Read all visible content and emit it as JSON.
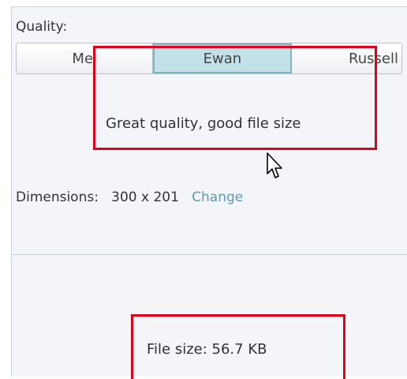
{
  "quality": {
    "label": "Quality:",
    "options": [
      "Mel",
      "Ewan",
      "Russell"
    ],
    "selected": "Ewan",
    "description": "Great quality, good file size"
  },
  "dimensions": {
    "label": "Dimensions:",
    "value": "300 x 201",
    "change_link": "Change"
  },
  "file_size": {
    "text": "File size: 56.7 KB"
  },
  "colors": {
    "selected_segment": "#c3e1e8",
    "selected_border": "#7db3c3",
    "link": "#5b9aae",
    "highlight": "#e0001a"
  },
  "icons": {
    "cursor": "mouse-pointer-icon"
  }
}
